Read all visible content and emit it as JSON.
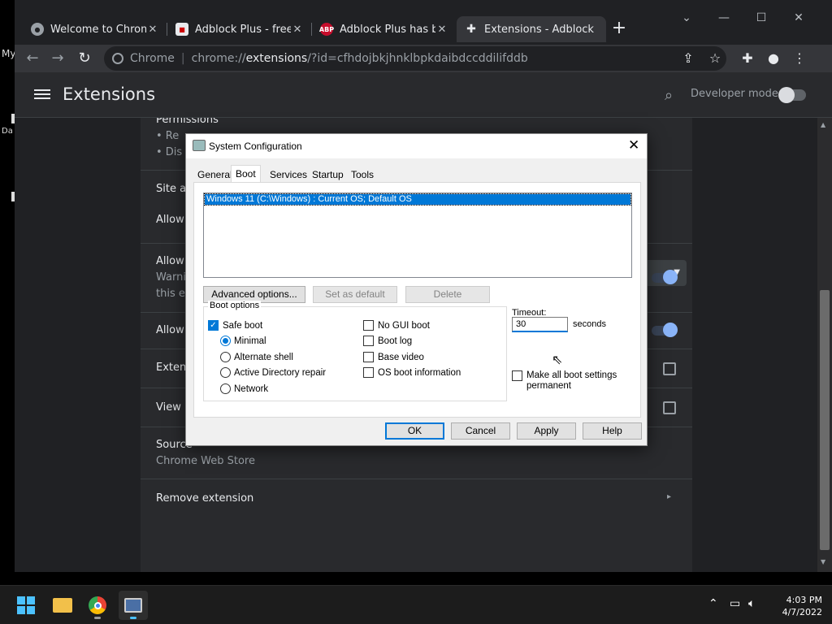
{
  "desktop": {
    "label1": "My",
    "label2": "Da"
  },
  "tabs": [
    {
      "title": "Welcome to Chrome",
      "icon": "globe-icon"
    },
    {
      "title": "Adblock Plus - free ad",
      "icon": "adblock-store-icon"
    },
    {
      "title": "Adblock Plus has bee",
      "icon": "abp-icon",
      "icon_text": "ABP"
    },
    {
      "title": "Extensions - Adblock",
      "icon": "puzzle-icon"
    }
  ],
  "window_controls": {
    "minimize": "—",
    "maximize": "☐",
    "close": "✕",
    "dropdown": "⌄"
  },
  "omnibox": {
    "site_label": "Chrome",
    "scheme": "chrome://",
    "host": "extensions",
    "path": "/?id=cfhdojbkjhnklbpkdaibdccddilifddb"
  },
  "ext_header": {
    "title": "Extensions",
    "dev_mode_label": "Developer mode"
  },
  "ext_details": {
    "permissions_title": "Permissions",
    "perm_item1": "• Re",
    "perm_item2": "• Dis",
    "site_access_title": "Site ac",
    "allow1": "Allow",
    "allow2": "Allow",
    "warning_line1": "Warni",
    "warning_line2": "this ex",
    "allow3": "Allow",
    "extension_options": "Extens",
    "view_in": "View i",
    "source_title": "Source",
    "source_value": "Chrome Web Store",
    "remove": "Remove extension"
  },
  "dialog": {
    "title": "System Configuration",
    "tabs": [
      "General",
      "Boot",
      "Services",
      "Startup",
      "Tools"
    ],
    "active_tab": "Boot",
    "os_entry": "Windows 11 (C:\\Windows) : Current OS; Default OS",
    "buttons": {
      "advanced": "Advanced options...",
      "set_default": "Set as default",
      "delete": "Delete"
    },
    "boot_options_legend": "Boot options",
    "safe_boot": {
      "label": "Safe boot",
      "checked": true
    },
    "radios": [
      {
        "label": "Minimal",
        "selected": true
      },
      {
        "label": "Alternate shell",
        "selected": false
      },
      {
        "label": "Active Directory repair",
        "selected": false
      },
      {
        "label": "Network",
        "selected": false
      }
    ],
    "right_checks": [
      {
        "label": "No GUI boot",
        "checked": false
      },
      {
        "label": "Boot log",
        "checked": false
      },
      {
        "label": "Base video",
        "checked": false
      },
      {
        "label": "OS boot information",
        "checked": false
      }
    ],
    "timeout_label": "Timeout:",
    "timeout_value": "30",
    "seconds_label": "seconds",
    "make_permanent_line1": "Make all boot settings",
    "make_permanent_line2": "permanent",
    "footer": {
      "ok": "OK",
      "cancel": "Cancel",
      "apply": "Apply",
      "help": "Help"
    }
  },
  "taskbar": {
    "time": "4:03 PM",
    "date": "4/7/2022"
  },
  "colors": {
    "accent": "#0078d7",
    "chrome_dark": "#202124",
    "toggle_blue": "#8ab4f8"
  }
}
